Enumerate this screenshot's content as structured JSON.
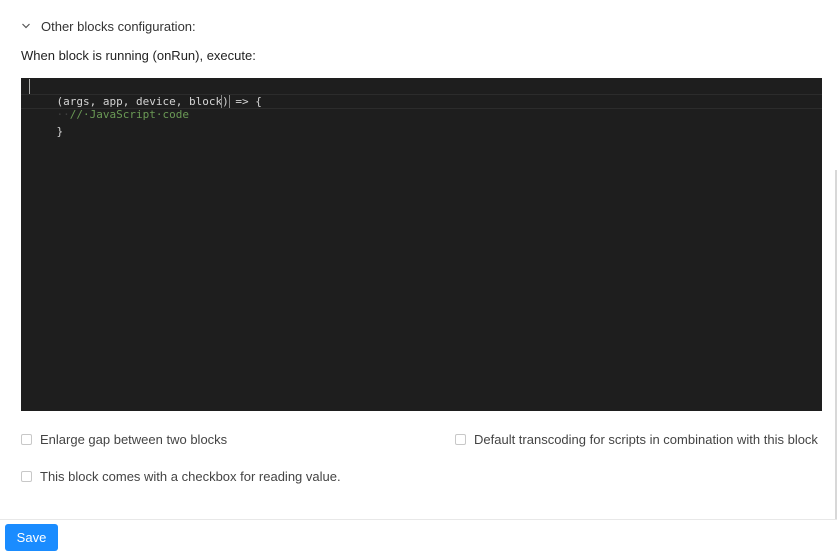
{
  "section": {
    "title": "Other blocks configuration:",
    "chevron_icon": "chevron-down-icon",
    "expanded": true
  },
  "onrun": {
    "label": "When block is running (onRun), execute:"
  },
  "editor": {
    "lines": [
      {
        "open_paren": "(",
        "params": "args, app, device, block",
        "close_paren": ")",
        "rest": " => {"
      },
      {
        "indent": "··",
        "comment": "//·JavaScript·code"
      },
      {
        "text": "}"
      }
    ],
    "colors": {
      "background": "#1e1e1e",
      "text": "#d4d4d4",
      "comment": "#6a9955"
    }
  },
  "options": {
    "enlarge_gap": {
      "label": "Enlarge gap between two blocks",
      "checked": false
    },
    "default_transcoding": {
      "label": "Default transcoding for scripts in combination with this block",
      "checked": false
    },
    "reading_checkbox": {
      "label": "This block comes with a checkbox for reading value.",
      "checked": false
    }
  },
  "footer": {
    "save_label": "Save",
    "accent_color": "#1a8cff"
  }
}
